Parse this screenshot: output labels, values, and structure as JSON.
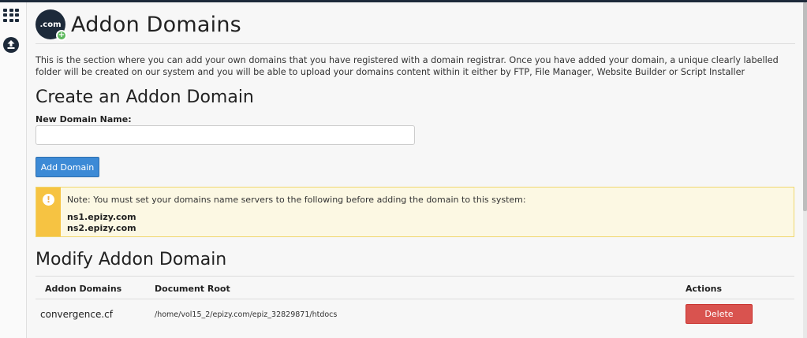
{
  "sidebar": {
    "items": [
      {
        "icon": "apps-grid-icon"
      },
      {
        "icon": "upload-icon"
      }
    ]
  },
  "header": {
    "logo_text": ".com",
    "logo_badge": "+",
    "title": "Addon Domains"
  },
  "description": "This is the section where you can add your own domains that you have registered with a domain registrar. Once you have added your domain, a unique clearly labelled folder will be created on our system and you will be able to upload your domains content within it either by FTP, File Manager, Website Builder or Script Installer",
  "create": {
    "title": "Create an Addon Domain",
    "field_label": "New Domain Name:",
    "input_value": "",
    "input_placeholder": "",
    "button_label": "Add Domain"
  },
  "alert": {
    "icon_glyph": "!",
    "text": "Note: You must set your domains name servers to the following before adding the domain to this system:",
    "nameservers": [
      "ns1.epizy.com",
      "ns2.epizy.com"
    ]
  },
  "modify": {
    "title": "Modify Addon Domain",
    "columns": [
      "Addon Domains",
      "Document Root",
      "Actions"
    ],
    "rows": [
      {
        "domain": "convergence.cf",
        "document_root": "/home/vol15_2/epizy.com/epiz_32829871/htdocs",
        "action_label": "Delete"
      }
    ]
  },
  "colors": {
    "primary": "#3c8ad6",
    "danger": "#d9534f",
    "warning": "#f6c342",
    "dark": "#1d2a3a"
  }
}
